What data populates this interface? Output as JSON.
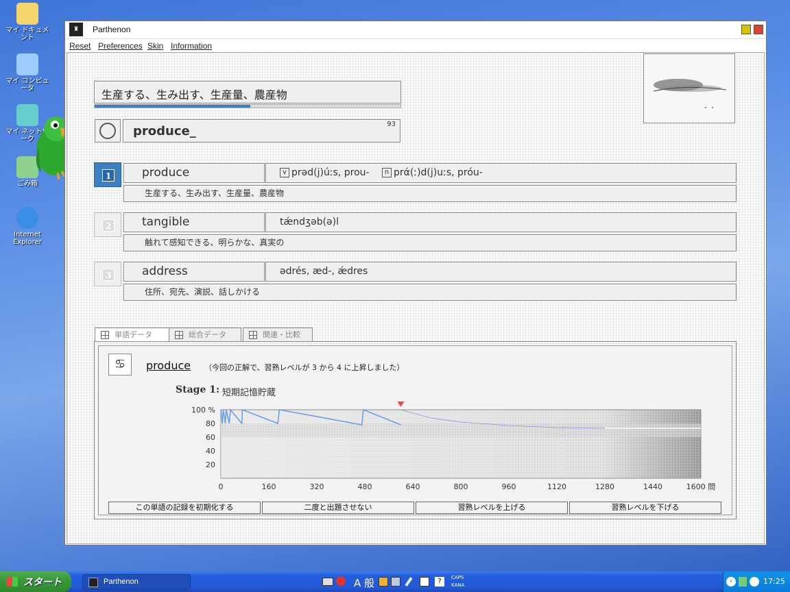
{
  "desktop": {
    "icons": [
      {
        "label": "マイ ドキュメント",
        "icon": "folder-icon",
        "color": "#f5d66a"
      },
      {
        "label": "マイ コンピュータ",
        "icon": "computer-icon",
        "color": "#9ecbff"
      },
      {
        "label": "マイ ネットワーク",
        "icon": "network-icon",
        "color": "#6cc"
      },
      {
        "label": "ごみ箱",
        "icon": "recycle-bin-icon",
        "color": "#8fd18f"
      },
      {
        "label": "Internet Explorer",
        "icon": "internet-explorer-icon",
        "color": "#3a8ee6"
      }
    ]
  },
  "window": {
    "title": "Parthenon",
    "menu": [
      "Reset",
      "Preferences",
      "Skin",
      "Information"
    ]
  },
  "quiz": {
    "question": "生産する、生み出す、生産量、農産物",
    "progress_percent": 51,
    "answer_input": "produce_",
    "counter": "93",
    "choices": [
      {
        "num": "1",
        "word": "produce",
        "pron_v_tag": "v",
        "pron_v": "prəd(j)úːs,  prou-",
        "pron_n_tag": "n",
        "pron_n": "prά(ː)d(j)uːs,  próu-",
        "meaning": "生産する、生み出す、生産量、農産物",
        "selected": true
      },
      {
        "num": "2",
        "word": "tangible",
        "pron": "tǽndʒəb(ə)l",
        "meaning": "触れて感知できる、明らかな、真実の",
        "selected": false
      },
      {
        "num": "3",
        "word": "address",
        "pron": "ədrés,  æd-,  ǽdres",
        "meaning": "住所、宛先、演説、話しかける",
        "selected": false
      }
    ]
  },
  "tabs": [
    "単語データ",
    "総合データ",
    "関連・比較"
  ],
  "word_data": {
    "sign": "♋",
    "word": "produce",
    "note": "（今回の正解で、習熟レベルが 3 から 4 に上昇しました）",
    "stage_label": "Stage 1:",
    "stage_name": "短期記憶貯蔵"
  },
  "chart_data": {
    "type": "line",
    "xlabel": "問",
    "ylabel": "%",
    "xlim": [
      0,
      1600
    ],
    "ylim": [
      0,
      100
    ],
    "x_ticks": [
      0,
      160,
      320,
      480,
      640,
      800,
      960,
      1120,
      1280,
      1440,
      1600
    ],
    "y_ticks": [
      20,
      40,
      60,
      80,
      100
    ],
    "y_tick_labels": [
      "20",
      "40",
      "60",
      "80",
      "100 %"
    ],
    "current_marker_x": 600,
    "series": [
      {
        "values": [
          [
            0,
            100
          ],
          [
            5,
            80
          ],
          [
            8,
            100
          ],
          [
            15,
            80
          ],
          [
            18,
            100
          ],
          [
            28,
            80
          ],
          [
            32,
            100
          ],
          [
            70,
            80
          ],
          [
            72,
            100
          ],
          [
            190,
            80
          ],
          [
            195,
            100
          ],
          [
            470,
            78
          ],
          [
            475,
            100
          ],
          [
            600,
            78
          ]
        ]
      },
      {
        "values": [
          [
            600,
            100
          ],
          [
            700,
            88
          ],
          [
            800,
            82
          ],
          [
            960,
            77
          ],
          [
            1120,
            74
          ],
          [
            1280,
            73
          ],
          [
            1440,
            73
          ],
          [
            1600,
            73
          ]
        ]
      }
    ]
  },
  "actions": [
    "この単語の記録を初期化する",
    "二度と出題させない",
    "習熟レベルを上げる",
    "習熟レベルを下げる"
  ],
  "taskbar": {
    "start": "スタート",
    "task": "Parthenon",
    "ime": "A 般",
    "caps": "CAPS",
    "kana": "KANA",
    "clock": "17:25"
  },
  "colors": {
    "accent": "#3c7fc4",
    "minimize": "#d7c200",
    "close": "#d9452f",
    "marker": "#e05050"
  }
}
